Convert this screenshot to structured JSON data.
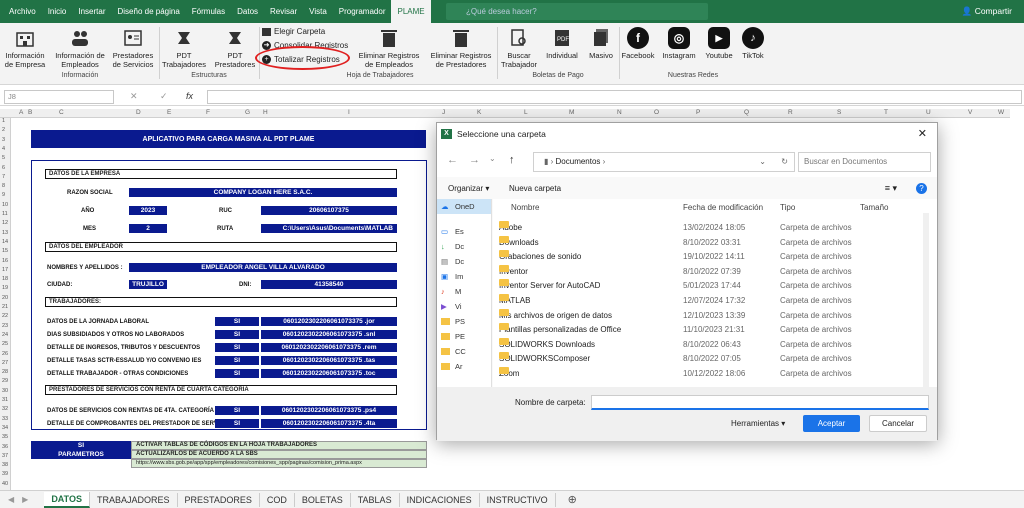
{
  "menubar": {
    "tabs": [
      "Archivo",
      "Inicio",
      "Insertar",
      "Diseño de página",
      "Fórmulas",
      "Datos",
      "Revisar",
      "Vista",
      "Programador",
      "PLAME"
    ],
    "search_placeholder": "¿Qué desea hacer?",
    "share_label": "Compartir"
  },
  "ribbon": {
    "buttons": [
      "Información de Empresa",
      "Información de Empleados",
      "Prestadores de Servicios",
      "PDT Trabajadores",
      "PDT Prestadores"
    ],
    "small_buttons": [
      "Elegir Carpeta",
      "Consolidar Registros",
      "Totalizar Registros"
    ],
    "more_buttons": [
      "Eliminar Registros de Empleados",
      "Eliminar Registros de Prestadores",
      "Buscar Trabajador",
      "Individual",
      "Masivo",
      "Facebook",
      "Instagram",
      "Youtube",
      "TikTok"
    ],
    "groups": [
      "Información",
      "Estructuras",
      "Hoja de Trabajadores",
      "Boletas de Pago",
      "Nuestras Redes"
    ]
  },
  "formula": {
    "cell": "J8",
    "fx": "fx"
  },
  "columns": [
    "A",
    "B",
    "C",
    "D",
    "E",
    "F",
    "G",
    "H",
    "I",
    "J",
    "K",
    "L",
    "M",
    "N",
    "O",
    "P",
    "Q",
    "R",
    "S",
    "T",
    "U",
    "V",
    "W"
  ],
  "rows": [
    "1",
    "2",
    "3",
    "4",
    "5",
    "6",
    "7",
    "8",
    "9",
    "10",
    "11",
    "12",
    "13",
    "14",
    "15",
    "16",
    "17",
    "18",
    "19",
    "20",
    "21",
    "22",
    "23",
    "24",
    "25",
    "26",
    "27",
    "28",
    "29",
    "30",
    "31",
    "32",
    "33",
    "34",
    "35",
    "36",
    "37",
    "38",
    "39",
    "40"
  ],
  "sheet": {
    "title": "APLICATIVO PARA CARGA MASIVA AL PDT PLAME",
    "company_section": "DATOS DE LA EMPRESA",
    "razon_label": "RAZON SOCIAL",
    "razon_value": "COMPANY LOGAN HERE S.A.C.",
    "anio_label": "AÑO",
    "anio_value": "2023",
    "ruc_label": "RUC",
    "ruc_value": "20606107375",
    "mes_label": "MES",
    "mes_value": "2",
    "ruta_label": "RUTA",
    "ruta_value": "C:\\Users\\Asus\\Documents\\MATLAB",
    "employer_section": "DATOS DEL EMPLEADOR",
    "nombres_label": "NOMBRES Y APELLIDOS :",
    "nombres_value": "EMPLEADOR ANGEL VILLA ALVARADO",
    "ciudad_label": "CIUDAD:",
    "ciudad_value": "TRUJILLO",
    "dni_label": "DNI:",
    "dni_value": "41358540",
    "workers_section": "TRABAJADORES:",
    "worker_rows": [
      {
        "label": "DATOS DE LA JORNADA LABORAL",
        "flag": "SI",
        "file": "0601202302206061073375 .jor"
      },
      {
        "label": "DIAS SUBSIDIADOS Y OTROS NO LABORADOS",
        "flag": "SI",
        "file": "0601202302206061073375 .snl"
      },
      {
        "label": "DETALLE DE INGRESOS, TRIBUTOS Y DESCUENTOS",
        "flag": "SI",
        "file": "0601202302206061073375 .rem"
      },
      {
        "label": "DETALLE TASAS SCTR-ESSALUD Y/O CONVENIO IES",
        "flag": "SI",
        "file": "0601202302206061073375 .tas"
      },
      {
        "label": "DETALLE TRABAJADOR - OTRAS CONDICIONES",
        "flag": "SI",
        "file": "0601202302206061073375 .toc"
      }
    ],
    "providers_section": "PRESTADORES DE SERVICIOS CON RENTA DE CUARTA CATEGORIA",
    "provider_rows": [
      {
        "label": "DATOS DE SERVICIOS CON RENTAS DE 4TA. CATEGORÍA",
        "flag": "SI",
        "file": "0601202302206061073375 .ps4"
      },
      {
        "label": "DETALLE DE COMPROBANTES DEL PRESTADOR DE SERVICIO",
        "flag": "SI",
        "file": "0601202302206061073375 .4ta"
      }
    ],
    "legend_si": "SI",
    "legend_si_text": "ACTIVAR TABLAS DE CÓDIGOS EN LA HOJA TRABAJADORES",
    "legend_param": "PARAMETROS",
    "legend_param_text": "ACTUALIZARLOS DE ACUERDO A LA SBS",
    "legend_url": "https://www.sbs.gob.pe/app/spp/empleadores/comisiones_spp/paginas/comision_prima.aspx"
  },
  "tabs": [
    "DATOS",
    "TRABAJADORES",
    "PRESTADORES",
    "COD",
    "BOLETAS",
    "TABLAS",
    "INDICACIONES",
    "INSTRUCTIVO"
  ],
  "dialog": {
    "title": "Seleccione una carpeta",
    "path": "Documentos",
    "search_placeholder": "Buscar en Documentos",
    "organize": "Organizar ▾",
    "new_folder": "Nueva carpeta",
    "headers": [
      "Nombre",
      "Fecha de modificación",
      "Tipo",
      "Tamaño"
    ],
    "nav": [
      "OneD",
      "Es",
      "Dc",
      "Dc",
      "Im",
      "M",
      "Vi",
      "PS",
      "PE",
      "CC",
      "Ar"
    ],
    "files": [
      {
        "name": "Adobe",
        "date": "13/02/2024 18:05",
        "type": "Carpeta de archivos"
      },
      {
        "name": "Downloads",
        "date": "8/10/2022 03:31",
        "type": "Carpeta de archivos"
      },
      {
        "name": "Grabaciones de sonido",
        "date": "19/10/2022 14:11",
        "type": "Carpeta de archivos"
      },
      {
        "name": "Inventor",
        "date": "8/10/2022 07:39",
        "type": "Carpeta de archivos"
      },
      {
        "name": "Inventor Server for AutoCAD",
        "date": "5/01/2023 17:44",
        "type": "Carpeta de archivos"
      },
      {
        "name": "MATLAB",
        "date": "12/07/2024 17:32",
        "type": "Carpeta de archivos"
      },
      {
        "name": "Mis archivos de origen de datos",
        "date": "12/10/2023 13:39",
        "type": "Carpeta de archivos"
      },
      {
        "name": "Plantillas personalizadas de Office",
        "date": "11/10/2023 21:31",
        "type": "Carpeta de archivos"
      },
      {
        "name": "SOLIDWORKS Downloads",
        "date": "8/10/2022 06:43",
        "type": "Carpeta de archivos"
      },
      {
        "name": "SOLIDWORKSComposer",
        "date": "8/10/2022 07:05",
        "type": "Carpeta de archivos"
      },
      {
        "name": "Zoom",
        "date": "10/12/2022 18:06",
        "type": "Carpeta de archivos"
      }
    ],
    "folder_label": "Nombre de carpeta:",
    "tools": "Herramientas",
    "accept": "Aceptar",
    "cancel": "Cancelar"
  }
}
